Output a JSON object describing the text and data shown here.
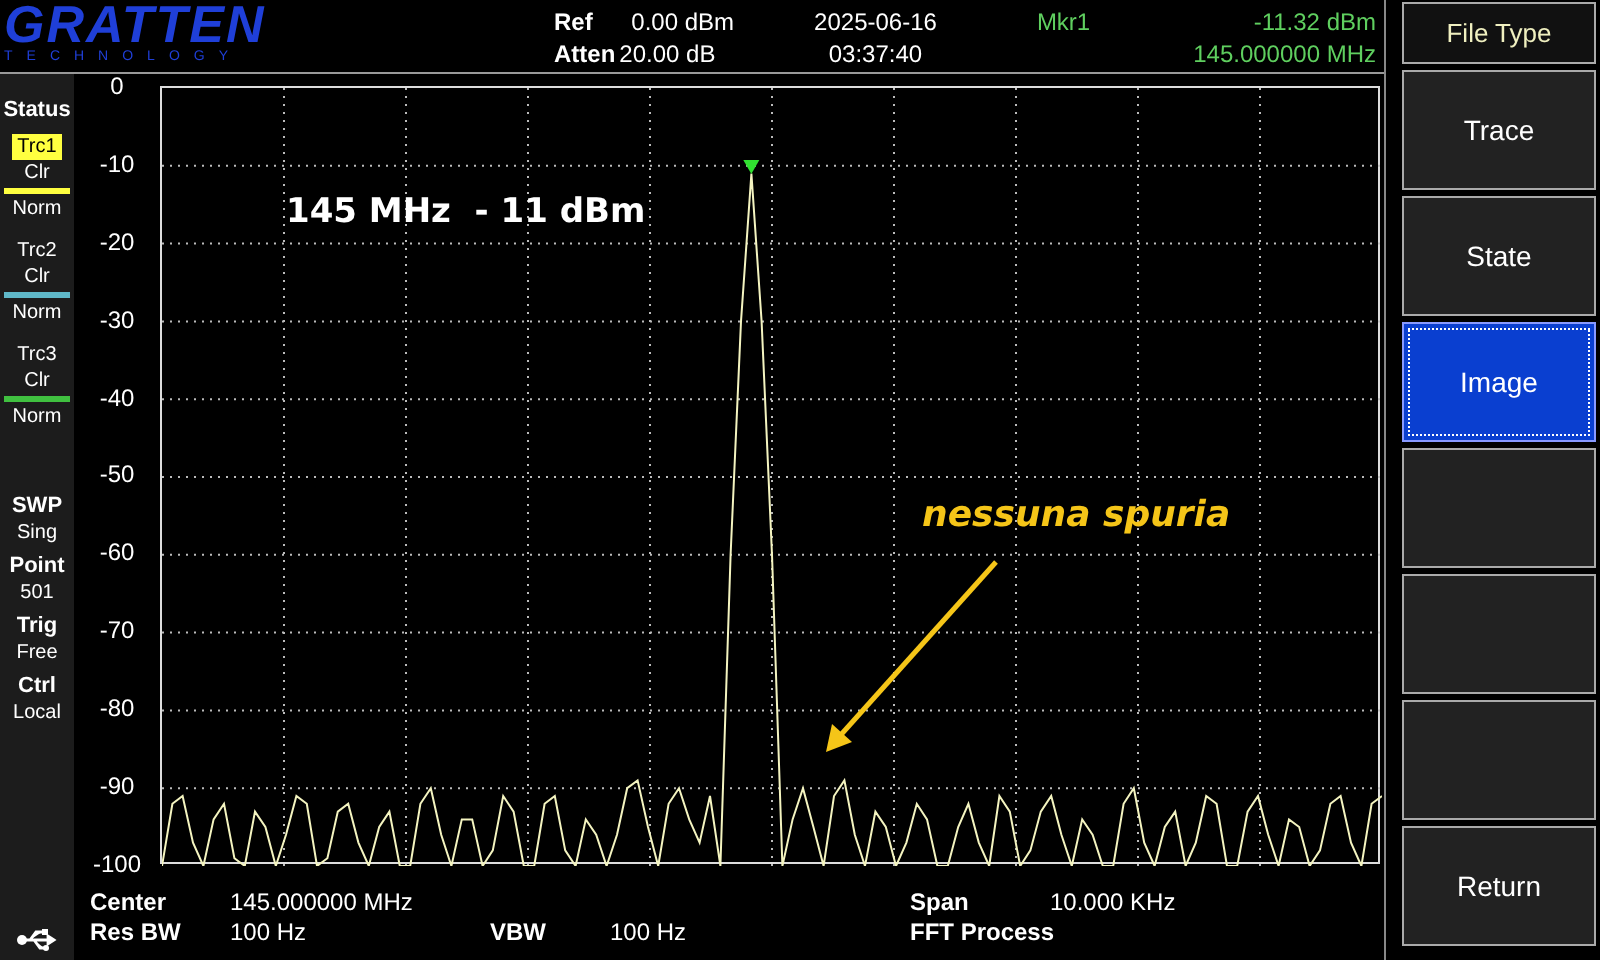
{
  "logo": {
    "name": "GRATTEN",
    "subtitle": "TECHNOLOGY"
  },
  "header": {
    "ref": {
      "label": "Ref",
      "value": "0.00 dBm"
    },
    "atten": {
      "label": "Atten",
      "value": "20.00 dB"
    },
    "date": "2025-06-16",
    "time": "03:37:40",
    "marker": {
      "label": "Mkr1",
      "amplitude": "-11.32 dBm",
      "frequency": "145.000000 MHz"
    }
  },
  "sidebar": {
    "title": "Status",
    "traces": [
      {
        "label": "Trc1",
        "selected": true,
        "mode": "Clr",
        "detector": "Norm",
        "color": "#ffff40"
      },
      {
        "label": "Trc2",
        "selected": false,
        "mode": "Clr",
        "detector": "Norm",
        "color": "#5fb8c8"
      },
      {
        "label": "Trc3",
        "selected": false,
        "mode": "Clr",
        "detector": "Norm",
        "color": "#40c040"
      }
    ],
    "settings": [
      {
        "label": "SWP",
        "value": "Sing"
      },
      {
        "label": "Point",
        "value": "501"
      },
      {
        "label": "Trig",
        "value": "Free"
      },
      {
        "label": "Ctrl",
        "value": "Local"
      }
    ]
  },
  "plot": {
    "chart_data": {
      "type": "line",
      "grid": true,
      "ylim": [
        -100,
        0
      ],
      "yticks": [
        0,
        -10,
        -20,
        -30,
        -40,
        -50,
        -60,
        -70,
        -80,
        -90,
        -100
      ],
      "series": [
        {
          "color": "#f4f4c0",
          "values": [
            -100,
            -92,
            -91,
            -97,
            -100,
            -94,
            -92,
            -99,
            -100,
            -93,
            -95,
            -100,
            -96,
            -91,
            -92,
            -100,
            -99,
            -93,
            -92,
            -97,
            -100,
            -95,
            -93,
            -100,
            -100,
            -92,
            -90,
            -96,
            -100,
            -94,
            -94,
            -100,
            -98,
            -91,
            -93,
            -100,
            -100,
            -92,
            -91,
            -98,
            -100,
            -94,
            -96,
            -100,
            -96,
            -90,
            -89,
            -95,
            -100,
            -92,
            -90,
            -94,
            -97,
            -91,
            -100,
            -60,
            -30,
            -11,
            -30,
            -60,
            -100,
            -94,
            -90,
            -95,
            -100,
            -91,
            -89,
            -96,
            -100,
            -93,
            -95,
            -100,
            -97,
            -92,
            -94,
            -100,
            -100,
            -95,
            -92,
            -97,
            -100,
            -91,
            -93,
            -100,
            -98,
            -93,
            -91,
            -96,
            -100,
            -94,
            -96,
            -100,
            -100,
            -92,
            -90,
            -97,
            -100,
            -95,
            -93,
            -100,
            -97,
            -91,
            -92,
            -100,
            -100,
            -93,
            -91,
            -96,
            -100,
            -94,
            -95,
            -100,
            -98,
            -92,
            -91,
            -97,
            -100,
            -92,
            -91
          ]
        }
      ]
    },
    "annotations": [
      {
        "kind": "peak",
        "text": "145 MHz  - 11 dBm"
      },
      {
        "kind": "note",
        "text": "nessuna spuria"
      }
    ]
  },
  "footer": {
    "center": {
      "label": "Center",
      "value": "145.000000 MHz"
    },
    "span": {
      "label": "Span",
      "value": "10.000 KHz"
    },
    "res_bw": {
      "label": "Res BW",
      "value": "100 Hz"
    },
    "vbw": {
      "label": "VBW",
      "value": "100 Hz"
    },
    "process": "FFT Process"
  },
  "softkeys": {
    "title": "File Type",
    "keys": [
      {
        "kind": "key",
        "label": "Trace",
        "selected": false
      },
      {
        "kind": "key",
        "label": "State",
        "selected": false
      },
      {
        "kind": "key",
        "label": "Image",
        "selected": true
      },
      {
        "kind": "blank"
      },
      {
        "kind": "blank"
      },
      {
        "kind": "blank"
      },
      {
        "kind": "key",
        "label": "Return",
        "selected": false
      }
    ]
  }
}
